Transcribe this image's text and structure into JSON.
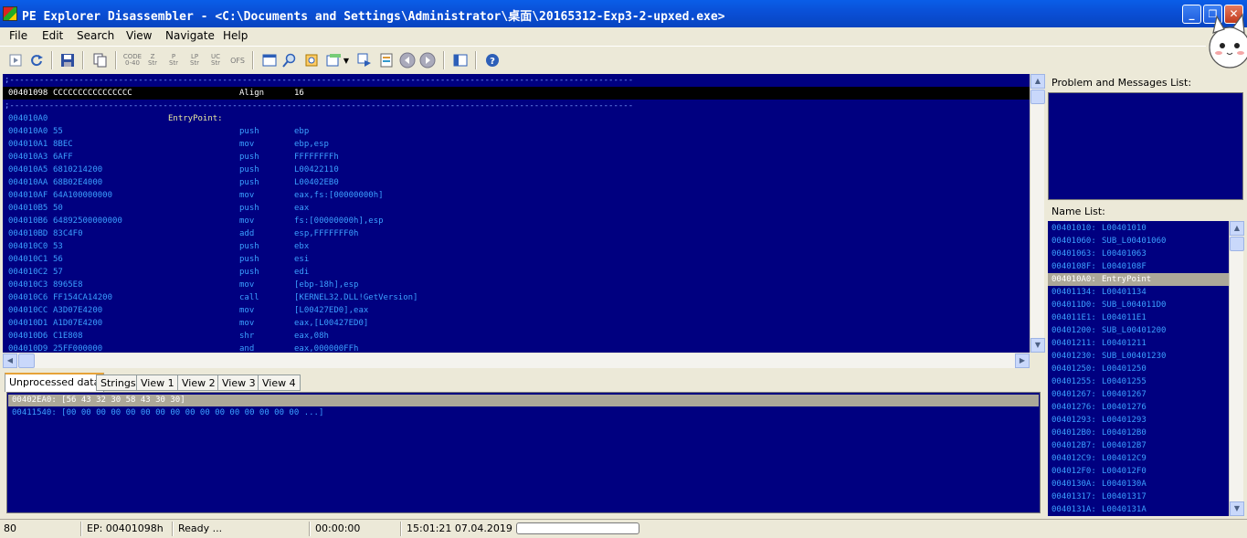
{
  "window": {
    "title": "PE Explorer Disassembler - <C:\\Documents and Settings\\Administrator\\桌面\\20165312-Exp3-2-upxed.exe>",
    "minimize": "_",
    "restore": "❐",
    "close": "✕"
  },
  "menu": [
    "File",
    "Edit",
    "Search",
    "View",
    "Navigate",
    "Help"
  ],
  "toolbar": {
    "small_labels": [
      {
        "top": "CODE",
        "bottom": "0-40"
      },
      {
        "top": "Z",
        "bottom": "Str"
      },
      {
        "top": "P",
        "bottom": "Str"
      },
      {
        "top": "LP",
        "bottom": "Str"
      },
      {
        "top": "UC",
        "bottom": "Str"
      },
      {
        "top": "",
        "bottom": "OFS"
      }
    ]
  },
  "disasm": {
    "separator": ";------------------------------------------------------------------------------------------------------------------------------",
    "selected": {
      "addr": "00401098",
      "bytes": "CCCCCCCCCCCCCCCC",
      "mnemonic": "Align",
      "operand": "16"
    },
    "entry": {
      "addr": "004010A0",
      "label": "EntryPoint:"
    },
    "lines": [
      {
        "addr": "004010A0",
        "bytes": "55",
        "mnemonic": "push",
        "operand": "ebp"
      },
      {
        "addr": "004010A1",
        "bytes": "8BEC",
        "mnemonic": "mov",
        "operand": "ebp,esp"
      },
      {
        "addr": "004010A3",
        "bytes": "6AFF",
        "mnemonic": "push",
        "operand": "FFFFFFFFh"
      },
      {
        "addr": "004010A5",
        "bytes": "6810214200",
        "mnemonic": "push",
        "operand": "L00422110"
      },
      {
        "addr": "004010AA",
        "bytes": "68B02E4000",
        "mnemonic": "push",
        "operand": "L00402EB0"
      },
      {
        "addr": "004010AF",
        "bytes": "64A100000000",
        "mnemonic": "mov",
        "operand": "eax,fs:[00000000h]"
      },
      {
        "addr": "004010B5",
        "bytes": "50",
        "mnemonic": "push",
        "operand": "eax"
      },
      {
        "addr": "004010B6",
        "bytes": "64892500000000",
        "mnemonic": "mov",
        "operand": "fs:[00000000h],esp"
      },
      {
        "addr": "004010BD",
        "bytes": "83C4F0",
        "mnemonic": "add",
        "operand": "esp,FFFFFFF0h"
      },
      {
        "addr": "004010C0",
        "bytes": "53",
        "mnemonic": "push",
        "operand": "ebx"
      },
      {
        "addr": "004010C1",
        "bytes": "56",
        "mnemonic": "push",
        "operand": "esi"
      },
      {
        "addr": "004010C2",
        "bytes": "57",
        "mnemonic": "push",
        "operand": "edi"
      },
      {
        "addr": "004010C3",
        "bytes": "8965E8",
        "mnemonic": "mov",
        "operand": "[ebp-18h],esp"
      },
      {
        "addr": "004010C6",
        "bytes": "FF154CA14200",
        "mnemonic": "call",
        "operand": "[KERNEL32.DLL!GetVersion]"
      },
      {
        "addr": "004010CC",
        "bytes": "A3D07E4200",
        "mnemonic": "mov",
        "operand": "[L00427ED0],eax"
      },
      {
        "addr": "004010D1",
        "bytes": "A1D07E4200",
        "mnemonic": "mov",
        "operand": "eax,[L00427ED0]"
      },
      {
        "addr": "004010D6",
        "bytes": "C1E808",
        "mnemonic": "shr",
        "operand": "eax,08h"
      },
      {
        "addr": "004010D9",
        "bytes": "25FF000000",
        "mnemonic": "and",
        "operand": "eax,000000FFh"
      }
    ]
  },
  "tabs": [
    "Unprocessed data",
    "Strings",
    "View 1",
    "View 2",
    "View 3",
    "View 4"
  ],
  "unprocessed": [
    "00402EA0:  [56 43 32 30 58 43 30 30]",
    "00411540:  [00 00 00 00 00 00 00 00 00 00 00 00 00 00 00 00 ...]"
  ],
  "problem_panel": {
    "title": "Problem and Messages List:"
  },
  "name_panel": {
    "title": "Name List:",
    "items": [
      {
        "addr": "00401010:",
        "name": "L00401010"
      },
      {
        "addr": "00401060:",
        "name": "SUB_L00401060"
      },
      {
        "addr": "00401063:",
        "name": "L00401063"
      },
      {
        "addr": "0040108F:",
        "name": "L0040108F"
      },
      {
        "addr": "004010A0:",
        "name": "EntryPoint"
      },
      {
        "addr": "00401134:",
        "name": "L00401134"
      },
      {
        "addr": "004011D0:",
        "name": "SUB_L004011D0"
      },
      {
        "addr": "004011E1:",
        "name": "L004011E1"
      },
      {
        "addr": "00401200:",
        "name": "SUB_L00401200"
      },
      {
        "addr": "00401211:",
        "name": "L00401211"
      },
      {
        "addr": "00401230:",
        "name": "SUB_L00401230"
      },
      {
        "addr": "00401250:",
        "name": "L00401250"
      },
      {
        "addr": "00401255:",
        "name": "L00401255"
      },
      {
        "addr": "00401267:",
        "name": "L00401267"
      },
      {
        "addr": "00401276:",
        "name": "L00401276"
      },
      {
        "addr": "00401293:",
        "name": "L00401293"
      },
      {
        "addr": "004012B0:",
        "name": "L004012B0"
      },
      {
        "addr": "004012B7:",
        "name": "L004012B7"
      },
      {
        "addr": "004012C9:",
        "name": "L004012C9"
      },
      {
        "addr": "004012F0:",
        "name": "L004012F0"
      },
      {
        "addr": "0040130A:",
        "name": "L0040130A"
      },
      {
        "addr": "00401317:",
        "name": "L00401317"
      },
      {
        "addr": "0040131A:",
        "name": "L0040131A"
      }
    ]
  },
  "status": {
    "line": "80",
    "ep": "EP: 00401098h",
    "state": "Ready ...",
    "elapsed": "00:00:00",
    "datetime": "15:01:21 07.04.2019",
    "progress": 0
  }
}
